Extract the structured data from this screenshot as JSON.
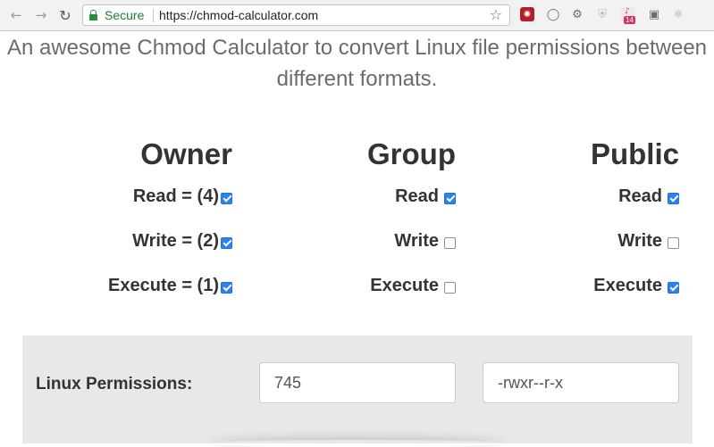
{
  "browser": {
    "back_icon": "arrow-left-icon",
    "forward_icon": "arrow-right-icon",
    "reload_icon": "reload-icon",
    "secure_label": "Secure",
    "url": "https://chmod-calculator.com",
    "star_icon": "bookmark-star-icon",
    "extensions": [
      {
        "name": "ext-red-tool-icon",
        "color": "#b3202b"
      },
      {
        "name": "ext-circle-icon"
      },
      {
        "name": "ext-gear-icon"
      },
      {
        "name": "ext-shield-icon"
      },
      {
        "name": "ext-calendar-icon",
        "badge": "14"
      },
      {
        "name": "ext-lightbulb-icon"
      },
      {
        "name": "ext-atom-icon"
      }
    ]
  },
  "page": {
    "tagline": "An awesome Chmod Calculator to convert Linux file permissions between different formats.",
    "columns": [
      {
        "title": "Owner",
        "rows": [
          {
            "label": "Read = (4)",
            "checked": true
          },
          {
            "label": "Write = (2)",
            "checked": true
          },
          {
            "label": "Execute = (1)",
            "checked": true
          }
        ]
      },
      {
        "title": "Group",
        "rows": [
          {
            "label": "Read",
            "checked": true
          },
          {
            "label": "Write",
            "checked": false
          },
          {
            "label": "Execute",
            "checked": false
          }
        ]
      },
      {
        "title": "Public",
        "rows": [
          {
            "label": "Read",
            "checked": true
          },
          {
            "label": "Write",
            "checked": false
          },
          {
            "label": "Execute",
            "checked": true
          }
        ]
      }
    ],
    "result": {
      "label": "Linux Permissions:",
      "numeric_value": "745",
      "symbolic_value": "-rwxr--r-x"
    }
  },
  "colors": {
    "accent": "#2a83ee",
    "secure_green": "#1e7d32",
    "panel_bg": "#e8e8e8"
  }
}
